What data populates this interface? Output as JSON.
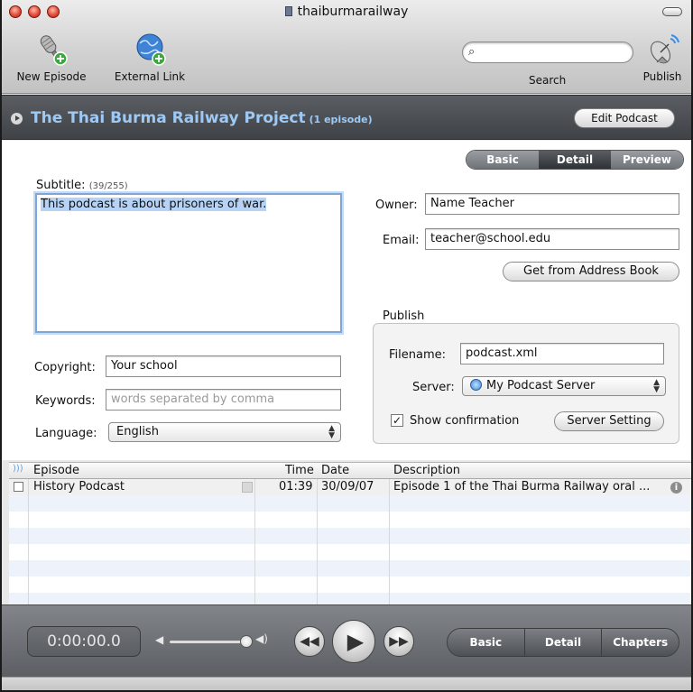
{
  "window": {
    "title": "thaiburmarailway",
    "traffic_light_color": "#e24b3a"
  },
  "toolbar": {
    "new_episode_label": "New Episode",
    "external_link_label": "External Link",
    "search_label": "Search",
    "search_placeholder": "",
    "publish_label": "Publish"
  },
  "header": {
    "title": "The Thai Burma Railway Project",
    "count": "(1 episode)",
    "edit_button": "Edit Podcast",
    "accent_color": "#9ec9f5"
  },
  "view_tabs": {
    "items": [
      "Basic",
      "Detail",
      "Preview"
    ],
    "selected": "Detail"
  },
  "form": {
    "subtitle_label": "Subtitle:",
    "subtitle_count": "(39/255)",
    "subtitle_value": "This podcast is about prisoners of war.",
    "owner_label": "Owner:",
    "owner_value": "Name Teacher",
    "email_label": "Email:",
    "email_value": "teacher@school.edu",
    "address_book_button": "Get from Address Book",
    "copyright_label": "Copyright:",
    "copyright_value": "Your school",
    "keywords_label": "Keywords:",
    "keywords_placeholder": "words separated by comma",
    "language_label": "Language:",
    "language_value": "English"
  },
  "publish": {
    "heading": "Publish",
    "filename_label": "Filename:",
    "filename_value": "podcast.xml",
    "server_label": "Server:",
    "server_value": "My Podcast Server",
    "show_confirmation_label": "Show confirmation",
    "show_confirmation_checked": true,
    "server_setting_button": "Server Setting"
  },
  "episodes": {
    "columns": [
      "Episode",
      "Time",
      "Date",
      "Description"
    ],
    "rows": [
      {
        "episode": "History Podcast",
        "time": "01:39",
        "date": "30/09/07",
        "description": "Episode 1 of the Thai Burma Railway oral ..."
      }
    ]
  },
  "player": {
    "timecode": "0:00:00.0",
    "volume": 1.0,
    "segments": [
      "Basic",
      "Detail",
      "Chapters"
    ]
  }
}
